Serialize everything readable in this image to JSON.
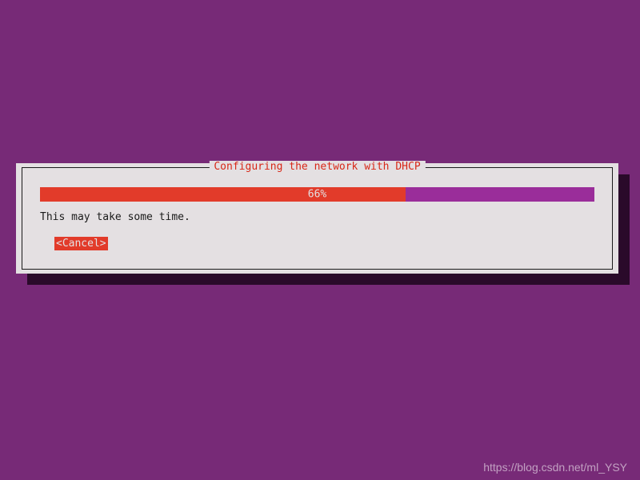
{
  "dialog": {
    "title": "Configuring the network with DHCP",
    "progress": {
      "percent": 66,
      "label": "66%"
    },
    "message": "This may take some time.",
    "cancel_label": "<Cancel>"
  },
  "watermark": "https://blog.csdn.net/ml_YSY"
}
